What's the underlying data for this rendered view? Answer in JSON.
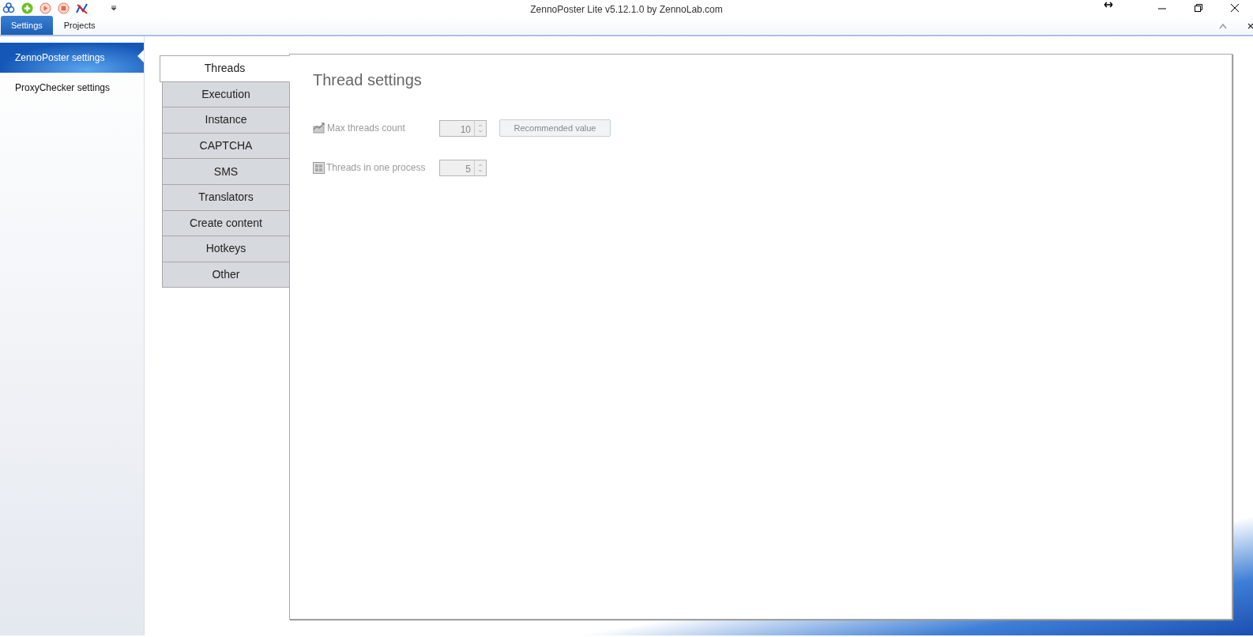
{
  "window": {
    "title": "ZennoPoster Lite v5.12.1.0 by ZennoLab.com"
  },
  "ribbon_tabs": [
    {
      "label": "Settings",
      "selected": true
    },
    {
      "label": "Projects",
      "selected": false
    }
  ],
  "sidebar": {
    "items": [
      {
        "label": "ZennoPoster settings",
        "selected": true
      },
      {
        "label": "ProxyChecker settings",
        "selected": false
      }
    ]
  },
  "settings_tabs": [
    {
      "label": "Threads",
      "selected": true
    },
    {
      "label": "Execution",
      "selected": false
    },
    {
      "label": "Instance",
      "selected": false
    },
    {
      "label": "CAPTCHA",
      "selected": false
    },
    {
      "label": "SMS",
      "selected": false
    },
    {
      "label": "Translators",
      "selected": false
    },
    {
      "label": "Create content",
      "selected": false
    },
    {
      "label": "Hotkeys",
      "selected": false
    },
    {
      "label": "Other",
      "selected": false
    }
  ],
  "panel": {
    "title": "Thread settings",
    "fields": [
      {
        "kind": "chart",
        "label": "Max threads count",
        "value": "10",
        "disabled": true,
        "button": {
          "label": "Recommended value",
          "disabled": true
        }
      },
      {
        "kind": "grid",
        "label": "Threads in one process",
        "value": "5",
        "disabled": true
      }
    ]
  }
}
